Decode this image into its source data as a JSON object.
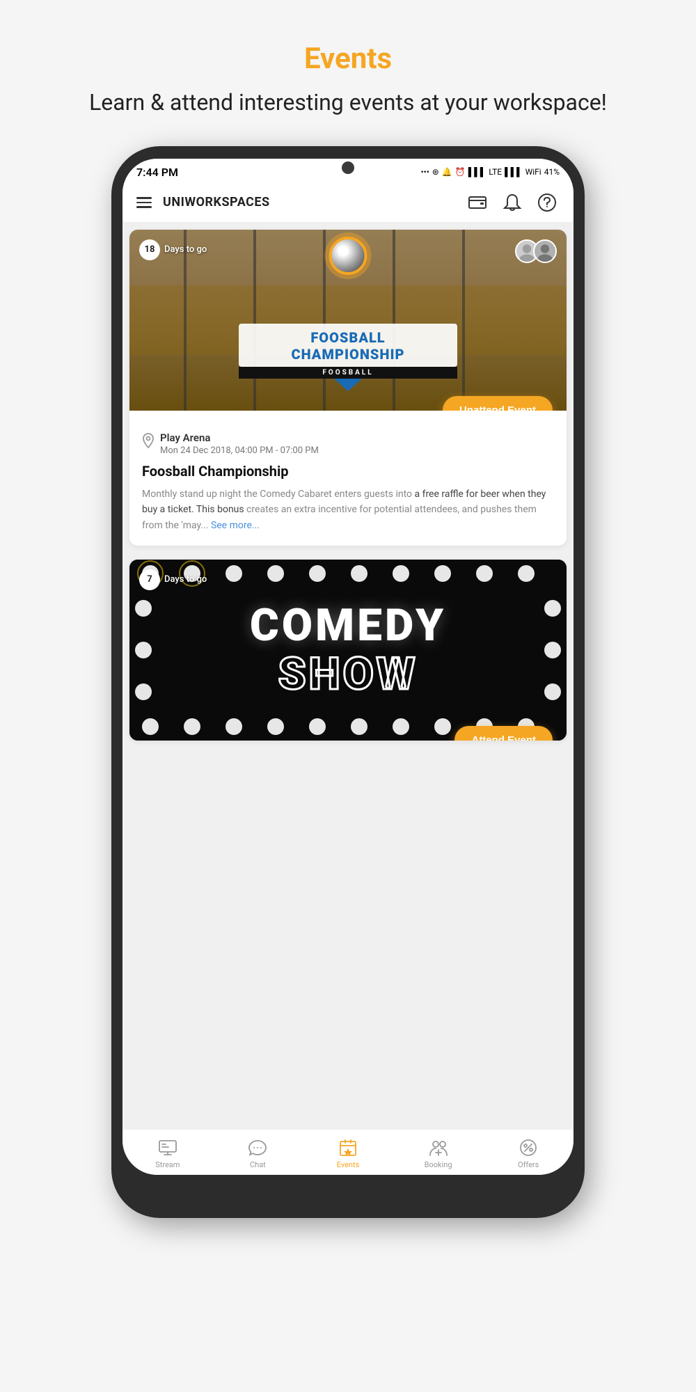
{
  "page": {
    "title": "Events",
    "subtitle": "Learn & attend interesting events at your workspace!",
    "title_color": "#f5a623"
  },
  "app": {
    "name": "UNIWORKSPACES",
    "time": "7:44 PM",
    "battery": "41%"
  },
  "events": [
    {
      "id": 1,
      "days_to_go": "18",
      "days_label": "Days to go",
      "location": "Play Arena",
      "datetime": "Mon 24 Dec 2018, 04:00 PM - 07:00 PM",
      "title": "Foosball Championship",
      "description": "Monthly stand up night the Comedy Cabaret enters guests into a free raffle for beer when they buy a ticket. This bonus creates an extra incentive for potential attendees, and pushes them from the 'may...",
      "see_more": "See more...",
      "action_label": "Unattend Event",
      "image_type": "foosball"
    },
    {
      "id": 2,
      "days_to_go": "7",
      "days_label": "Days to go",
      "title": "Comedy Show",
      "action_label": "Attend Event",
      "image_type": "comedy"
    }
  ],
  "nav": {
    "items": [
      {
        "id": "stream",
        "label": "Stream",
        "active": false
      },
      {
        "id": "chat",
        "label": "Chat",
        "active": false
      },
      {
        "id": "events",
        "label": "Events",
        "active": true
      },
      {
        "id": "booking",
        "label": "Booking",
        "active": false
      },
      {
        "id": "offers",
        "label": "Offers",
        "active": false
      }
    ]
  }
}
